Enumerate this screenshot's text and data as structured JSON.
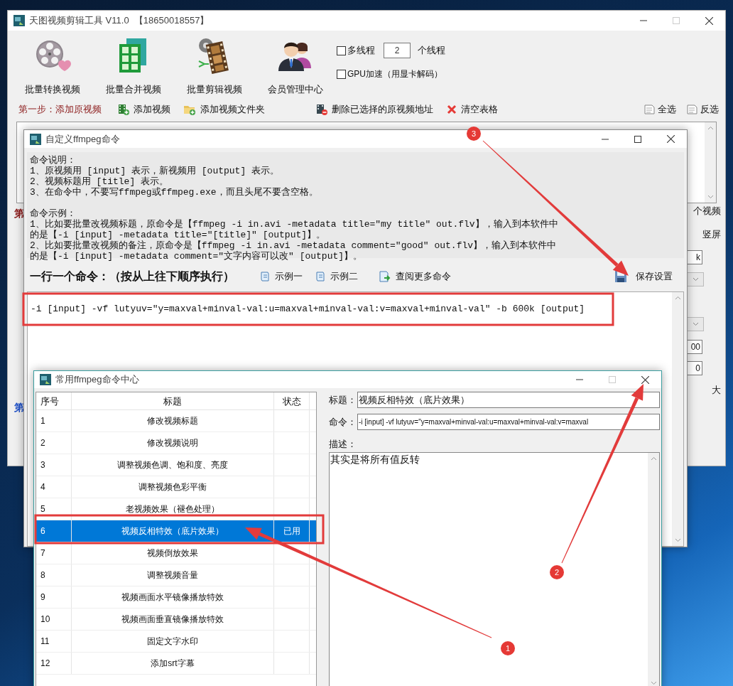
{
  "main_window": {
    "title": "天图视频剪辑工具 V11.0  【18650018557】",
    "tools": [
      {
        "label": "批量转换视频",
        "kind": "reel"
      },
      {
        "label": "批量合并视频",
        "kind": "merge"
      },
      {
        "label": "批量剪辑视频",
        "kind": "strip"
      },
      {
        "label": "会员管理中心",
        "kind": "members"
      }
    ],
    "multithread": {
      "label": "多线程",
      "checked": false,
      "value": "2",
      "unit": "个线程"
    },
    "gpu": {
      "label": "GPU加速（用显卡解码）",
      "checked": false
    },
    "step_label": "第一步：添加原视频",
    "actions": [
      {
        "label": "添加视频",
        "kind": "add-video"
      },
      {
        "label": "添加视频文件夹",
        "kind": "add-folder"
      },
      {
        "label": "删除已选择的原视频地址",
        "kind": "delete"
      },
      {
        "label": "清空表格",
        "kind": "clear"
      }
    ],
    "select_actions": [
      {
        "label": "全选"
      },
      {
        "label": "反选"
      }
    ],
    "left_fragments": [
      {
        "text": "第",
        "color": "#8b1a1a"
      },
      {
        "text": "第",
        "color": "#1e50c8"
      }
    ],
    "right_fragments": [
      {
        "kind": "text",
        "text": "个视频"
      },
      {
        "kind": "text",
        "text": "竖屏"
      },
      {
        "kind": "input",
        "text": "k"
      },
      {
        "kind": "select"
      },
      {
        "kind": "select"
      },
      {
        "kind": "input",
        "text": "00"
      },
      {
        "kind": "input",
        "text": "0"
      },
      {
        "kind": "text",
        "text": "大"
      }
    ]
  },
  "custom_dialog": {
    "title": "自定义ffmpeg命令",
    "help_sections": [
      {
        "heading": "命令说明：",
        "lines": [
          "1、原视频用 [input] 表示，新视频用 [output] 表示。",
          "2、视频标题用 [title] 表示。",
          "3、在命令中，不要写ffmpeg或ffmpeg.exe，而且头尾不要含空格。"
        ]
      },
      {
        "heading": "命令示例：",
        "lines": [
          "1、比如要批量改视频标题，原命令是【ffmpeg -i in.avi -metadata title=\"my title\" out.flv】，输入到本软件中的是【-i [input] -metadata title=\"[title]\" [output]】。",
          "2、比如要批量改视频的备注，原命令是【ffmpeg -i in.avi -metadata comment=\"good\" out.flv】，输入到本软件中的是【-i [input] -metadata comment=\"文字内容可以改\" [output]】。"
        ]
      }
    ],
    "command_label": "一行一个命令：（按从上往下顺序执行）",
    "buttons": [
      {
        "label": "示例一",
        "kind": "scroll"
      },
      {
        "label": "示例二",
        "kind": "scroll"
      },
      {
        "label": "查阅更多命令",
        "kind": "open"
      }
    ],
    "save_button": "保存设置",
    "commands": [
      "-i [input] -vf lutyuv=\"y=maxval+minval-val:u=maxval+minval-val:v=maxval+minval-val\" -b 600k [output]"
    ]
  },
  "command_center": {
    "title": "常用ffmpeg命令中心",
    "columns": [
      "序号",
      "标题",
      "状态"
    ],
    "rows": [
      {
        "no": "1",
        "title": "修改视频标题",
        "selected": false
      },
      {
        "no": "2",
        "title": "修改视频说明",
        "selected": false
      },
      {
        "no": "3",
        "title": "调整视频色调、饱和度、亮度",
        "selected": false
      },
      {
        "no": "4",
        "title": "调整视频色彩平衡",
        "selected": false
      },
      {
        "no": "5",
        "title": "老视频效果（褪色处理）",
        "selected": false
      },
      {
        "no": "6",
        "title": "视频反相特效（底片效果）",
        "status": "已用",
        "selected": true
      },
      {
        "no": "7",
        "title": "视频倒放效果",
        "selected": false
      },
      {
        "no": "8",
        "title": "调整视频音量",
        "selected": false
      },
      {
        "no": "9",
        "title": "视频画面水平镜像播放特效",
        "selected": false
      },
      {
        "no": "10",
        "title": "视频画面垂直镜像播放特效",
        "selected": false
      },
      {
        "no": "11",
        "title": "固定文字水印",
        "selected": false
      },
      {
        "no": "12",
        "title": "添加srt字幕",
        "selected": false
      }
    ],
    "title_label": "标题：",
    "title_value": "视频反相特效（底片效果）",
    "command_label": "命令：",
    "command_value": "-i [input] -vf lutyuv=\"y=maxval+minval-val:u=maxval+minval-val:v=maxval",
    "description_label": "描述：",
    "description_value": "其实是将所有值反转"
  },
  "annotations": [
    {
      "number": "1"
    },
    {
      "number": "2"
    },
    {
      "number": "3"
    }
  ]
}
